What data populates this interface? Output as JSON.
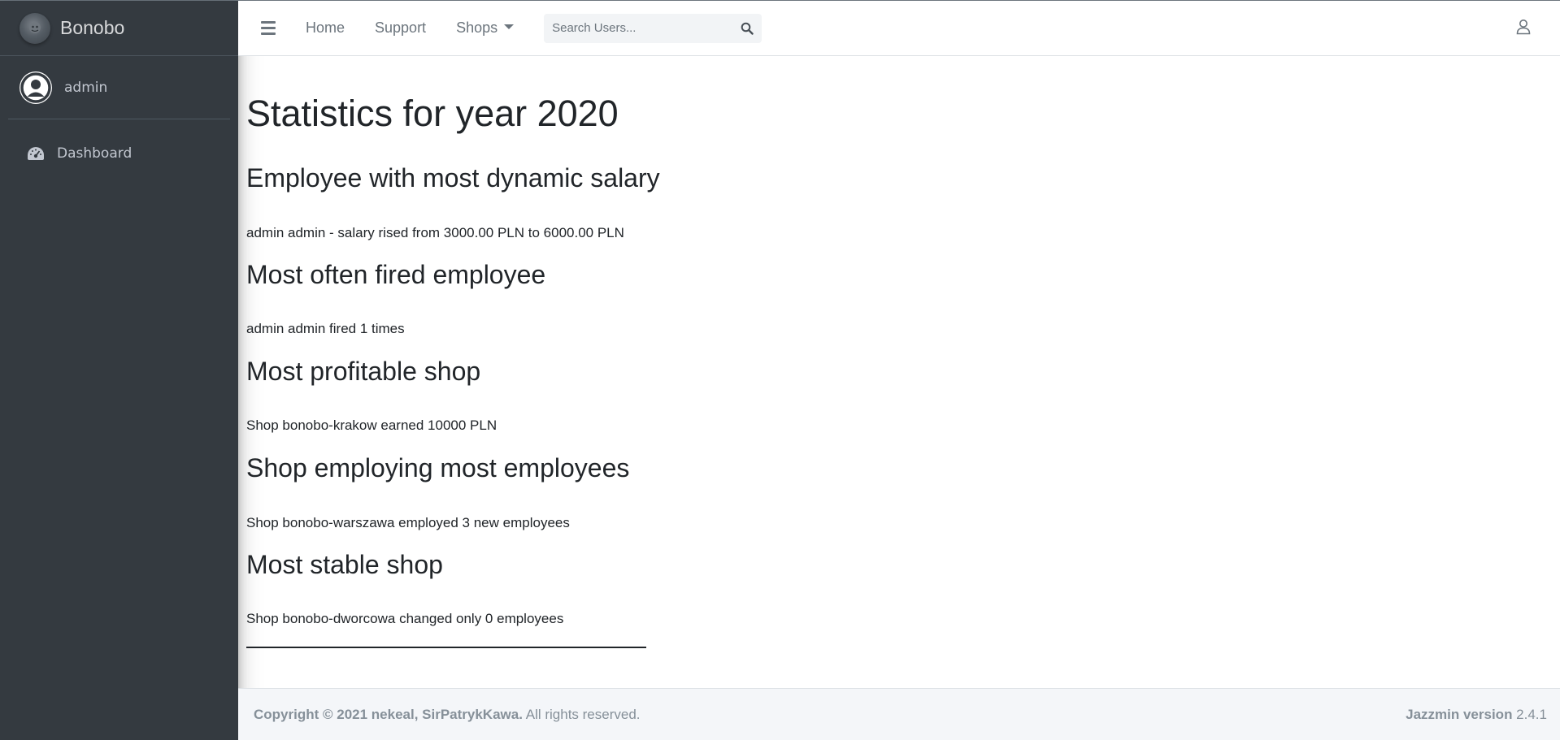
{
  "brand": {
    "name": "Bonobo",
    "logo_icon": "bonobo-logo"
  },
  "sidebar": {
    "user": {
      "name": "admin",
      "icon": "user-circle-icon"
    },
    "items": [
      {
        "label": "Dashboard",
        "icon": "tachometer-icon"
      }
    ]
  },
  "navbar": {
    "menu_icon": "hamburger-icon",
    "links": [
      {
        "label": "Home"
      },
      {
        "label": "Support"
      },
      {
        "label": "Shops"
      }
    ],
    "search": {
      "placeholder": "Search Users...",
      "icon": "search-icon"
    },
    "user_icon": "user-outline-icon"
  },
  "main": {
    "title": "Statistics for year 2020",
    "sections": [
      {
        "heading": "Employee with most dynamic salary",
        "text": "admin admin - salary rised from 3000.00 PLN to 6000.00 PLN"
      },
      {
        "heading": "Most often fired employee",
        "text": "admin admin fired 1 times"
      },
      {
        "heading": "Most profitable shop",
        "text": "Shop bonobo-krakow earned 10000 PLN"
      },
      {
        "heading": "Shop employing most employees",
        "text": "Shop bonobo-warszawa employed 3 new employees"
      },
      {
        "heading": "Most stable shop",
        "text": "Shop bonobo-dworcowa changed only 0 employees"
      }
    ]
  },
  "footer": {
    "copyright_bold": "Copyright © 2021 nekeal, SirPatrykKawa.",
    "copyright_rest": " All rights reserved.",
    "version_label": "Jazzmin version",
    "version_value": " 2.4.1"
  },
  "colors": {
    "sidebar_bg": "#343a40",
    "sidebar_text": "#c2c7d0",
    "navbar_link": "#6c757d",
    "footer_bg": "#f4f6f9",
    "footer_text": "#869099"
  }
}
